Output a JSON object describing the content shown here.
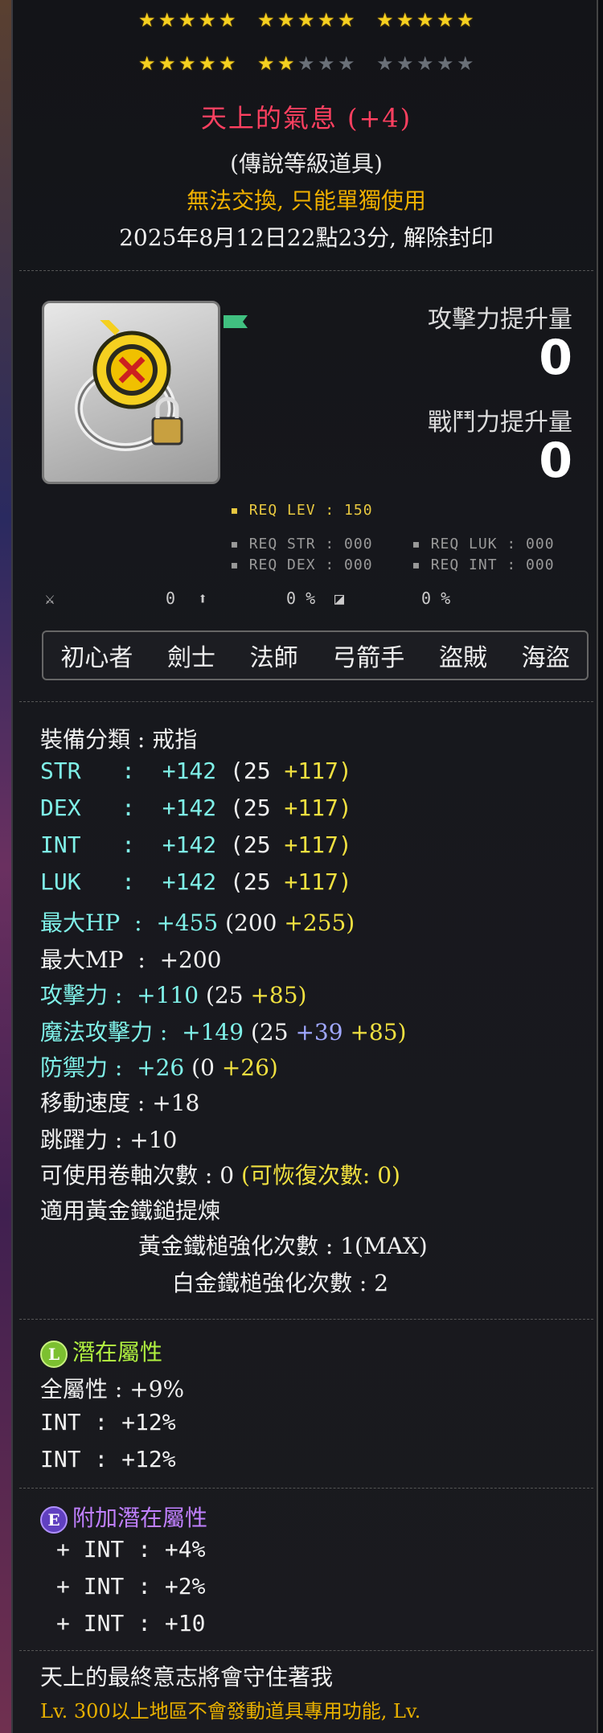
{
  "stars": {
    "filled": 22,
    "total": 30
  },
  "item": {
    "name": "天上的氣息 (+4)",
    "grade": "(傳說等級道具)",
    "trade": "無法交換, 只能單獨使用",
    "unseal": "2025年8月12日22點23分, 解除封印"
  },
  "compare": {
    "attack_label": "攻擊力提升量",
    "attack_value": "0",
    "combat_label": "戰鬥力提升量",
    "combat_value": "0"
  },
  "req": {
    "lev": "REQ LEV : 150",
    "str": "REQ STR : 000",
    "luk": "REQ LUK : 000",
    "dex": "REQ DEX : 000",
    "int": "REQ INT : 000"
  },
  "icons_row": {
    "v1": "0",
    "v2": "0 %",
    "v3": "0 %"
  },
  "jobs": [
    "初心者",
    "劍士",
    "法師",
    "弓箭手",
    "盜賊",
    "海盜"
  ],
  "stats": {
    "category": "裝備分類 : 戒指",
    "str": {
      "label": "STR",
      "total": "+142",
      "base": "(25",
      "bonus": "+117)"
    },
    "dex": {
      "label": "DEX",
      "total": "+142",
      "base": "(25",
      "bonus": "+117)"
    },
    "int": {
      "label": "INT",
      "total": "+142",
      "base": "(25",
      "bonus": "+117)"
    },
    "luk": {
      "label": "LUK",
      "total": "+142",
      "base": "(25",
      "bonus": "+117)"
    },
    "maxhp": {
      "label": "最大HP",
      "total": "+455",
      "base": "(200",
      "bonus": "+255)"
    },
    "maxmp": {
      "label": "最大MP",
      "total": "+200"
    },
    "atk": {
      "label": "攻擊力",
      "total": "+110",
      "base": "(25",
      "bonus": "+85)"
    },
    "matk": {
      "label": "魔法攻擊力",
      "total": "+149",
      "base": "(25",
      "bonus1": "+39",
      "bonus2": "+85)"
    },
    "def": {
      "label": "防禦力",
      "total": "+26",
      "base": "(0",
      "bonus": "+26)"
    },
    "speed": "移動速度 : +18",
    "jump": "跳躍力 : +10",
    "scroll_prefix": "可使用卷軸次數 : 0 ",
    "scroll_recover": "(可恢復次數: 0)",
    "hammer_title": "適用黃金鐵鎚提煉",
    "golden_hammer": "黃金鐵槌強化次數 : 1(MAX)",
    "platinum_hammer": "白金鐵槌強化次數 : 2"
  },
  "potential": {
    "badge": "L",
    "title": "潛在屬性",
    "lines": [
      "全屬性 : +9%",
      "INT : +12%",
      "INT : +12%"
    ]
  },
  "additional": {
    "badge": "E",
    "title": "附加潛在屬性",
    "lines": [
      "+ INT : +4%",
      "+ INT : +2%",
      "+ INT : +10"
    ]
  },
  "description": {
    "line1": "天上的最終意志將會守住著我",
    "line2": "Lv. 300以上地區不會發動道具專用功能, Lv."
  }
}
